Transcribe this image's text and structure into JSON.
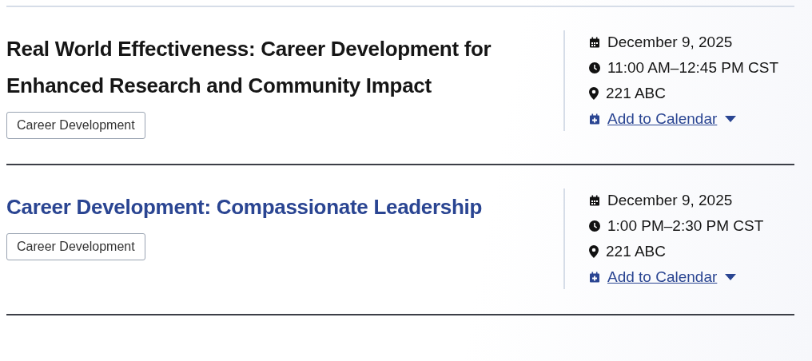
{
  "events": [
    {
      "title": "Real World Effectiveness: Career Development for Enhanced Research and Community Impact",
      "linked": false,
      "tag": "Career Development",
      "date": "December 9, 2025",
      "time": "11:00 AM–12:45 PM CST",
      "location": "221 ABC",
      "calendar_link": "Add to Calendar"
    },
    {
      "title": "Career Development: Compassionate Leadership",
      "linked": true,
      "tag": "Career Development",
      "date": "December 9, 2025",
      "time": "1:00 PM–2:30 PM CST",
      "location": "221 ABC",
      "calendar_link": "Add to Calendar"
    }
  ]
}
